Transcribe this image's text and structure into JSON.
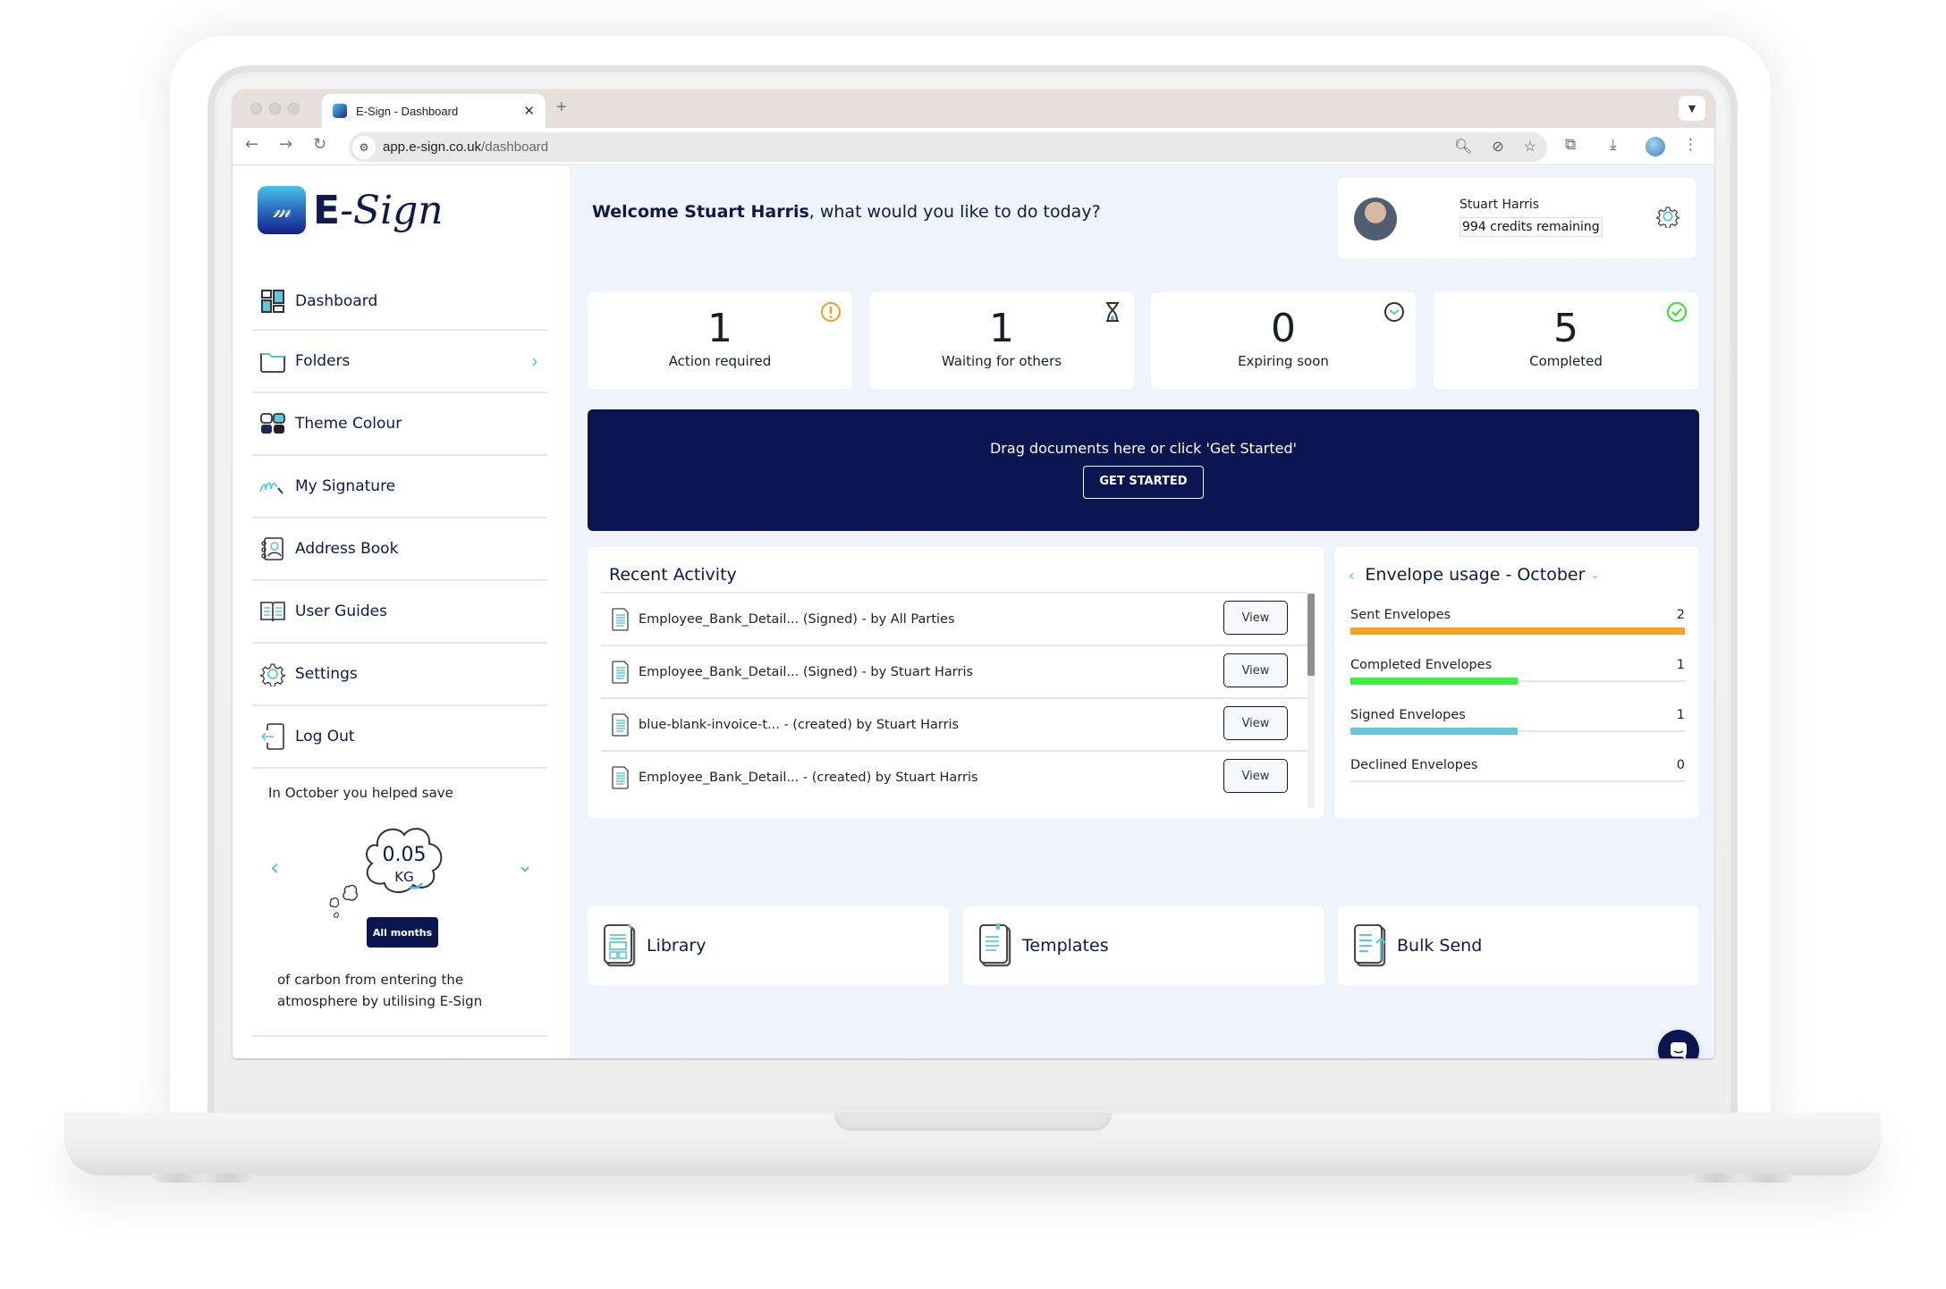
{
  "browser": {
    "tab_title": "E-Sign - Dashboard",
    "new_tab": "+",
    "url_host": "app.e-sign.co.uk",
    "url_path": "/dashboard"
  },
  "brand": {
    "name_e": "E",
    "name_sign": "-Sign"
  },
  "sidebar": {
    "items": [
      {
        "label": "Dashboard",
        "icon": "dashboard-icon"
      },
      {
        "label": "Folders",
        "icon": "folder-icon",
        "has_chevron": true
      },
      {
        "label": "Theme Colour",
        "icon": "theme-icon"
      },
      {
        "label": "My Signature",
        "icon": "signature-icon"
      },
      {
        "label": "Address Book",
        "icon": "address-book-icon"
      },
      {
        "label": "User Guides",
        "icon": "book-icon"
      },
      {
        "label": "Settings",
        "icon": "gear-icon"
      },
      {
        "label": "Log Out",
        "icon": "logout-icon"
      }
    ],
    "carbon": {
      "heading": "In October you helped save",
      "value": "0.05",
      "unit": "KG",
      "button": "All months",
      "footer": "of carbon from entering the atmosphere by utilising E-Sign"
    }
  },
  "header": {
    "welcome_name": "Welcome Stuart Harris",
    "welcome_rest": ", what would you like to do today?",
    "user_name": "Stuart Harris",
    "credits": "994 credits remaining"
  },
  "stats": [
    {
      "value": "1",
      "label": "Action required",
      "icon": "alert-icon",
      "color": "#f39c1f"
    },
    {
      "value": "1",
      "label": "Waiting for others",
      "icon": "hourglass-icon",
      "color": "#4bbfdc"
    },
    {
      "value": "0",
      "label": "Expiring soon",
      "icon": "clock-icon",
      "color": "#4bbfdc"
    },
    {
      "value": "5",
      "label": "Completed",
      "icon": "check-circle-icon",
      "color": "#33dd33"
    }
  ],
  "dropzone": {
    "text": "Drag documents here or click 'Get Started'",
    "button": "GET STARTED"
  },
  "recent_activity": {
    "title": "Recent Activity",
    "view_label": "View",
    "rows": [
      {
        "text": "Employee_Bank_Detail... (Signed) - by All Parties"
      },
      {
        "text": "Employee_Bank_Detail... (Signed) - by Stuart Harris"
      },
      {
        "text": "blue-blank-invoice-t... - (created) by Stuart Harris"
      },
      {
        "text": "Employee_Bank_Detail... - (created) by Stuart Harris"
      }
    ]
  },
  "envelope_usage": {
    "title": "Envelope usage - October",
    "max": 2,
    "rows": [
      {
        "label": "Sent Envelopes",
        "value": 2,
        "color": "#f7a024"
      },
      {
        "label": "Completed Envelopes",
        "value": 1,
        "color": "#3df03d"
      },
      {
        "label": "Signed Envelopes",
        "value": 1,
        "color": "#66c7de"
      },
      {
        "label": "Declined Envelopes",
        "value": 0,
        "color": "#e05050"
      }
    ]
  },
  "shortcuts": [
    {
      "label": "Library",
      "icon": "library-icon"
    },
    {
      "label": "Templates",
      "icon": "templates-icon"
    },
    {
      "label": "Bulk Send",
      "icon": "bulk-send-icon"
    }
  ],
  "colors": {
    "navy": "#0b1650",
    "accent": "#4bbfdc",
    "page_bg": "#eef3fc"
  }
}
